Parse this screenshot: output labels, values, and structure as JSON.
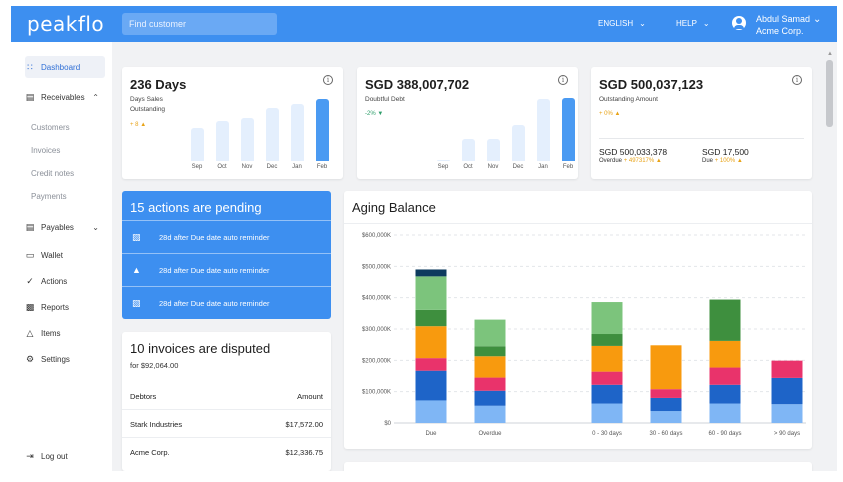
{
  "app": {
    "logo": "peakflo"
  },
  "header": {
    "search_placeholder": "Find customer",
    "language": "ENGLISH",
    "help": "HELP",
    "user_name": "Abdul Samad",
    "user_company": "Acme Corp."
  },
  "sidebar": {
    "dashboard": "Dashboard",
    "receivables": "Receivables",
    "receivables_sub": [
      "Customers",
      "Invoices",
      "Credit notes",
      "Payments"
    ],
    "payables": "Payables",
    "wallet": "Wallet",
    "actions": "Actions",
    "reports": "Reports",
    "items": "Items",
    "settings": "Settings",
    "logout": "Log out"
  },
  "kpi1": {
    "title": "236 Days",
    "sub1": "Days Sales",
    "sub2": "Outstanding",
    "delta": "+ 8",
    "months": [
      "Sep",
      "Oct",
      "Nov",
      "Dec",
      "Jan",
      "Feb"
    ],
    "bar_levels": [
      0.38,
      0.46,
      0.49,
      0.6,
      0.65,
      0.7
    ]
  },
  "kpi2": {
    "title": "SGD 388,007,702",
    "sub1": "Doubtful Debt",
    "delta": "-2%",
    "months": [
      "Sep",
      "Oct",
      "Nov",
      "Dec",
      "Jan",
      "Feb"
    ],
    "bar_levels": [
      0.01,
      0.25,
      0.25,
      0.41,
      0.71,
      0.72
    ]
  },
  "kpi3": {
    "title": "SGD 500,037,123",
    "sub1": "Outstanding Amount",
    "delta": "+ 0%",
    "overdue_amount": "SGD 500,033,378",
    "overdue_label": "Overdue",
    "overdue_delta": "+ 497317%",
    "due_amount": "SGD 17,500",
    "due_label": "Due",
    "due_delta": "+ 100%"
  },
  "pending": {
    "title": "15 actions are pending",
    "rows": [
      {
        "icon": "message-icon",
        "text": "28d after Due date auto reminder"
      },
      {
        "icon": "bell-icon",
        "text": "28d after Due date auto reminder"
      },
      {
        "icon": "message-icon",
        "text": "28d after Due date auto reminder"
      }
    ]
  },
  "disputed": {
    "title": "10 invoices are disputed",
    "subtitle": "for $92,064.00",
    "col_debtors": "Debtors",
    "col_amount": "Amount",
    "rows": [
      {
        "debtor": "Stark Industries",
        "amount": "$17,572.00"
      },
      {
        "debtor": "Acme Corp.",
        "amount": "$12,336.75"
      }
    ]
  },
  "aging": {
    "title": "Aging Balance"
  },
  "chart_data": {
    "type": "bar",
    "stacked": true,
    "title": "Aging Balance",
    "categories": [
      "Due",
      "Overdue",
      "0 - 30 days",
      "30 - 60 days",
      "60 - 90 days",
      "> 90 days"
    ],
    "y_ticks": [
      "$0",
      "$100,000K",
      "$200,000K",
      "$300,000K",
      "$400,000K",
      "$500,000K",
      "$600,000K"
    ],
    "ylim": [
      0,
      600000
    ],
    "grid": true,
    "colors": [
      "#7fb6f5",
      "#1e64c8",
      "#e9336b",
      "#f89a0e",
      "#3e8f3e",
      "#7cc47c",
      "#0d3b5e"
    ],
    "series": [
      {
        "values": [
          72000,
          55000,
          62000,
          38000,
          62000,
          60000
        ]
      },
      {
        "values": [
          95000,
          48000,
          60000,
          42000,
          60000,
          84000
        ]
      },
      {
        "values": [
          40000,
          42000,
          42000,
          28000,
          55000,
          55000
        ]
      },
      {
        "values": [
          102000,
          68000,
          82000,
          0,
          85000,
          0
        ]
      },
      {
        "values": [
          52000,
          32000,
          38000,
          0,
          132000,
          0
        ]
      },
      {
        "values": [
          107000,
          85000,
          102000,
          0,
          0,
          0
        ]
      },
      {
        "values": [
          22000,
          0,
          0,
          0,
          0,
          0
        ]
      }
    ],
    "single_series_values": [
      0,
      0,
      0,
      140000,
      0,
      0
    ],
    "single_series_color": "#f89a0e"
  }
}
